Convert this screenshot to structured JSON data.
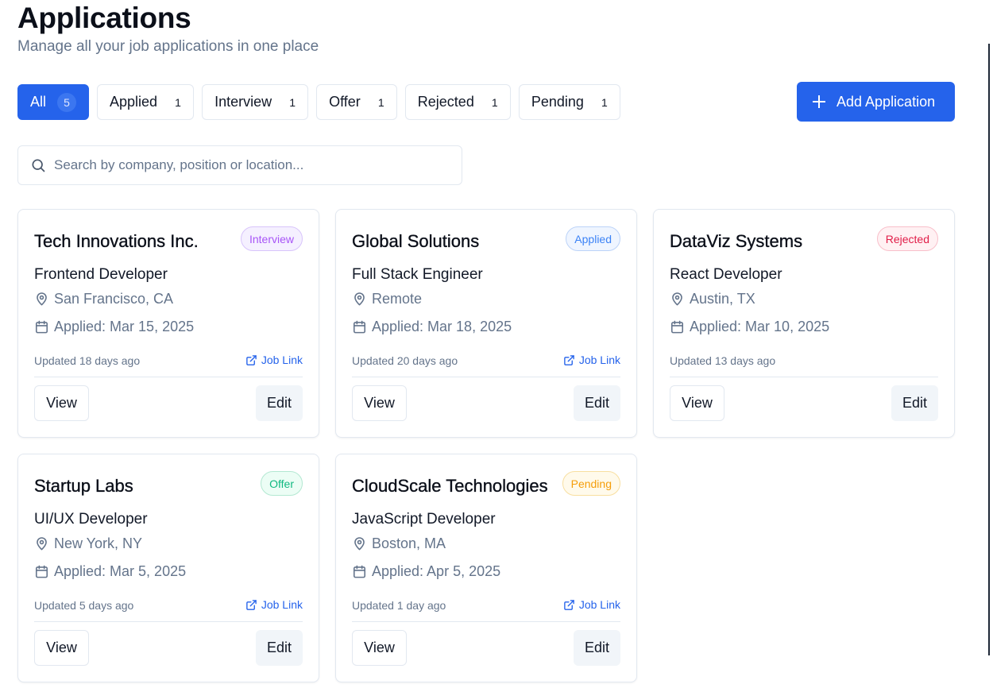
{
  "header": {
    "title": "Applications",
    "subtitle": "Manage all your job applications in one place"
  },
  "filters": [
    {
      "label": "All",
      "count": "5",
      "active": true
    },
    {
      "label": "Applied",
      "count": "1"
    },
    {
      "label": "Interview",
      "count": "1"
    },
    {
      "label": "Offer",
      "count": "1"
    },
    {
      "label": "Rejected",
      "count": "1"
    },
    {
      "label": "Pending",
      "count": "1"
    }
  ],
  "add_button": {
    "label": "Add Application",
    "icon": "plus-icon"
  },
  "search": {
    "placeholder": "Search by company, position or location...",
    "value": "",
    "icon": "search-icon"
  },
  "colors": {
    "primary": "#2563eb",
    "interview": "#a855f7",
    "applied": "#3b82f6",
    "rejected": "#e11d48",
    "offer": "#10b981",
    "pending": "#f59e0b"
  },
  "cards": [
    {
      "company": "Tech Innovations Inc.",
      "status": "Interview",
      "position": "Frontend Developer",
      "location": "San Francisco, CA",
      "applied": "Applied: Mar 15, 2025",
      "updated": "Updated 18 days ago",
      "job_link": "Job Link",
      "view": "View",
      "edit": "Edit"
    },
    {
      "company": "Global Solutions",
      "status": "Applied",
      "position": "Full Stack Engineer",
      "location": "Remote",
      "applied": "Applied: Mar 18, 2025",
      "updated": "Updated 20 days ago",
      "job_link": "Job Link",
      "view": "View",
      "edit": "Edit"
    },
    {
      "company": "DataViz Systems",
      "status": "Rejected",
      "position": "React Developer",
      "location": "Austin, TX",
      "applied": "Applied: Mar 10, 2025",
      "updated": "Updated 13 days ago",
      "job_link": "",
      "view": "View",
      "edit": "Edit"
    },
    {
      "company": "Startup Labs",
      "status": "Offer",
      "position": "UI/UX Developer",
      "location": "New York, NY",
      "applied": "Applied: Mar 5, 2025",
      "updated": "Updated 5 days ago",
      "job_link": "Job Link",
      "view": "View",
      "edit": "Edit"
    },
    {
      "company": "CloudScale Technologies",
      "status": "Pending",
      "position": "JavaScript Developer",
      "location": "Boston, MA",
      "applied": "Applied: Apr 5, 2025",
      "updated": "Updated 1 day ago",
      "job_link": "Job Link",
      "view": "View",
      "edit": "Edit"
    }
  ]
}
